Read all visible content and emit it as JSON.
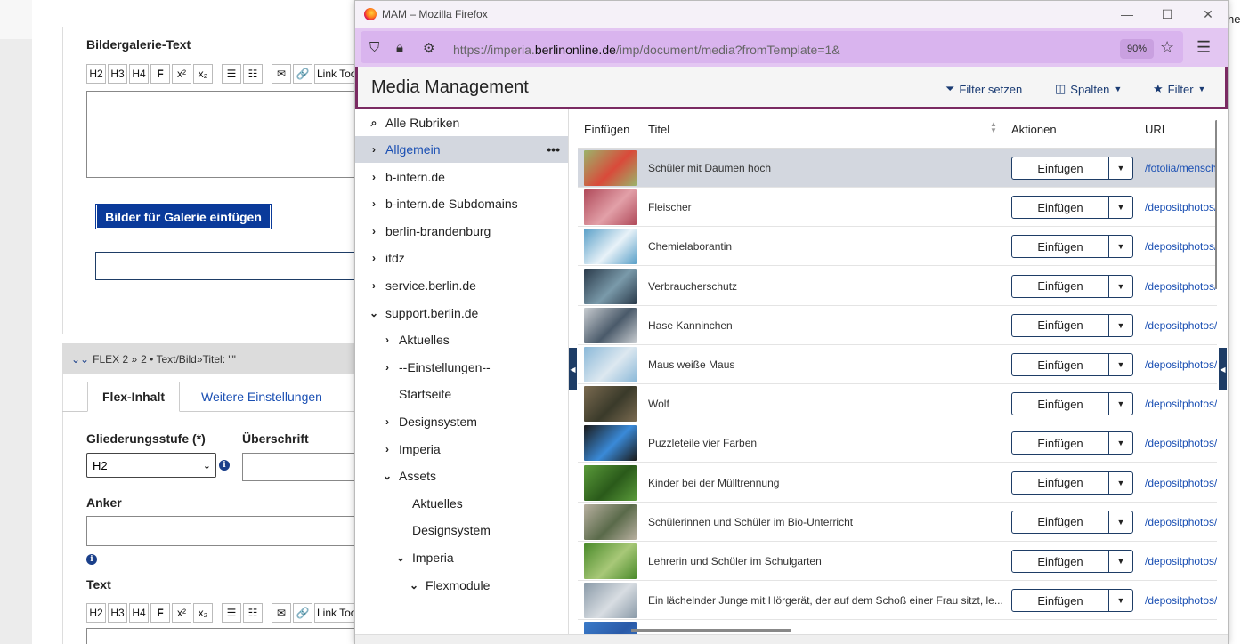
{
  "background_page": {
    "gallery_text_label": "Bildergalerie-Text",
    "toolbar": [
      "H2",
      "H3",
      "H4",
      "F",
      "x²",
      "x₂",
      "☰",
      "☷",
      "✉",
      "🔗",
      "Link Tool"
    ],
    "gallery_button": "Bilder für Galerie einfügen",
    "flex_header": {
      "prefix": "FLEX 2 »",
      "detail": "2 • Text/Bild»Titel: \"\""
    },
    "tabs": {
      "flex_content": "Flex-Inhalt",
      "more_settings": "Weitere Einstellungen"
    },
    "outline_label": "Gliederungsstufe (*)",
    "heading_label": "Überschrift",
    "outline_value": "H2",
    "anchor_label": "Anker",
    "text_label": "Text",
    "cut_text": "he"
  },
  "window": {
    "title": "MAM – Mozilla Firefox",
    "url_prefix": "https://imperia.",
    "url_domain": "berlinonline.de",
    "url_path": "/imp/document/media?fromTemplate=1&",
    "zoom": "90%"
  },
  "app": {
    "title": "Media Management",
    "filter_set": "Filter setzen",
    "columns_btn": "Spalten",
    "filter_btn": "Filter"
  },
  "tree": {
    "all": "Alle Rubriken",
    "items": [
      {
        "label": "Allgemein",
        "level": 0,
        "state": "collapsed",
        "active": true
      },
      {
        "label": "b-intern.de",
        "level": 0,
        "state": "collapsed"
      },
      {
        "label": "b-intern.de Subdomains",
        "level": 0,
        "state": "collapsed"
      },
      {
        "label": "berlin-brandenburg",
        "level": 0,
        "state": "collapsed"
      },
      {
        "label": "itdz",
        "level": 0,
        "state": "collapsed"
      },
      {
        "label": "service.berlin.de",
        "level": 0,
        "state": "collapsed"
      },
      {
        "label": "support.berlin.de",
        "level": 0,
        "state": "expanded"
      },
      {
        "label": "Aktuelles",
        "level": 1,
        "state": "collapsed"
      },
      {
        "label": "--Einstellungen--",
        "level": 1,
        "state": "collapsed"
      },
      {
        "label": "Startseite",
        "level": 1,
        "state": "leaf"
      },
      {
        "label": "Designsystem",
        "level": 1,
        "state": "collapsed"
      },
      {
        "label": "Imperia",
        "level": 1,
        "state": "collapsed"
      },
      {
        "label": "Assets",
        "level": 1,
        "state": "expanded"
      },
      {
        "label": "Aktuelles",
        "level": 2,
        "state": "leaf"
      },
      {
        "label": "Designsystem",
        "level": 2,
        "state": "leaf"
      },
      {
        "label": "Imperia",
        "level": 2,
        "state": "expanded"
      },
      {
        "label": "Flexmodule",
        "level": 3,
        "state": "expanded"
      }
    ]
  },
  "table": {
    "headers": {
      "insert": "Einfügen",
      "title": "Titel",
      "actions": "Aktionen",
      "uri": "URI"
    },
    "action_label": "Einfügen",
    "rows": [
      {
        "title": "Schüler mit Daumen hoch",
        "uri": "/fotolia/mensch",
        "thumb": "#9bb36a",
        "thumb2": "#d94a3a"
      },
      {
        "title": "Fleischer",
        "uri": "/depositphotos/",
        "thumb": "#b04a5a",
        "thumb2": "#e2a0a8"
      },
      {
        "title": "Chemielaborantin",
        "uri": "/depositphotos/",
        "thumb": "#5aa0c8",
        "thumb2": "#e8f2f8"
      },
      {
        "title": "Verbraucherschutz",
        "uri": "/depositphotos/",
        "thumb": "#2a3a4a",
        "thumb2": "#7a9aaa"
      },
      {
        "title": "Hase Kanninchen",
        "uri": "/depositphotos/",
        "thumb": "#c8ccd0",
        "thumb2": "#4a5a6a"
      },
      {
        "title": "Maus weiße Maus",
        "uri": "/depositphotos/",
        "thumb": "#8ab8d8",
        "thumb2": "#dde8f0"
      },
      {
        "title": "Wolf",
        "uri": "/depositphotos/",
        "thumb": "#7a6a50",
        "thumb2": "#3a3a2a"
      },
      {
        "title": "Puzzleteile vier Farben",
        "uri": "/depositphotos/",
        "thumb": "#1a1a1a",
        "thumb2": "#3a8ad8"
      },
      {
        "title": "Kinder bei der Mülltrennung",
        "uri": "/depositphotos/",
        "thumb": "#5a9a3a",
        "thumb2": "#2a5a1a"
      },
      {
        "title": "Schülerinnen und Schüler im Bio-Unterricht",
        "uri": "/depositphotos/",
        "thumb": "#b8b0a0",
        "thumb2": "#5a6a4a"
      },
      {
        "title": "Lehrerin und Schüler im Schulgarten",
        "uri": "/depositphotos/",
        "thumb": "#4a8a2a",
        "thumb2": "#a8c878"
      },
      {
        "title": "Ein lächelnder Junge mit Hörgerät, der auf dem Schoß einer Frau sitzt, le...",
        "uri": "/depositphotos/",
        "thumb": "#8a9aa8",
        "thumb2": "#d8dde2"
      },
      {
        "title": "",
        "uri": "",
        "thumb": "#3a7ac8",
        "thumb2": "#2a5aa8"
      }
    ]
  },
  "colors": {
    "accent": "#7a2a62",
    "navy": "#1e3d66",
    "link": "#1a4fb3",
    "urlbar": "#e3c6f2"
  }
}
